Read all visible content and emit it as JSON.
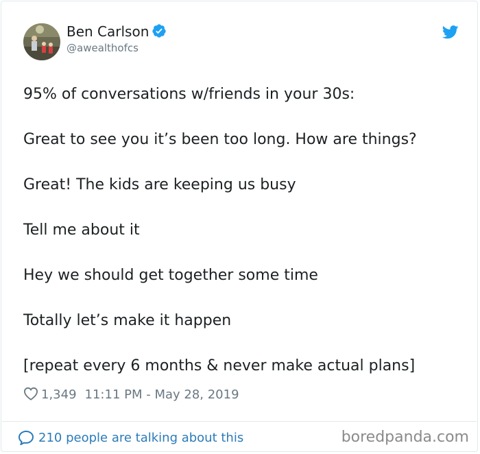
{
  "tweet": {
    "author_name": "Ben Carlson",
    "author_handle": "@awealthofcs",
    "lines": [
      "95% of conversations w/friends in your 30s:",
      "Great to see you it’s been too long. How are things?",
      "Great! The kids are keeping us busy",
      "Tell me about it",
      "Hey we should get together some time",
      "Totally let’s make it happen",
      "[repeat every 6 months & never make actual plans]"
    ],
    "likes": "1,349",
    "timestamp": "11:11 PM - May 28, 2019",
    "talking": "210 people are talking about this"
  },
  "watermark": "boredpanda.com",
  "colors": {
    "twitter_blue": "#1da1f2",
    "link_blue": "#2b7bb9",
    "muted_gray": "#697882",
    "text": "#1c2022"
  },
  "icons": {
    "verified": "verified-badge-icon",
    "bird": "twitter-bird-icon",
    "heart": "heart-icon",
    "bubble": "comment-bubble-icon"
  }
}
